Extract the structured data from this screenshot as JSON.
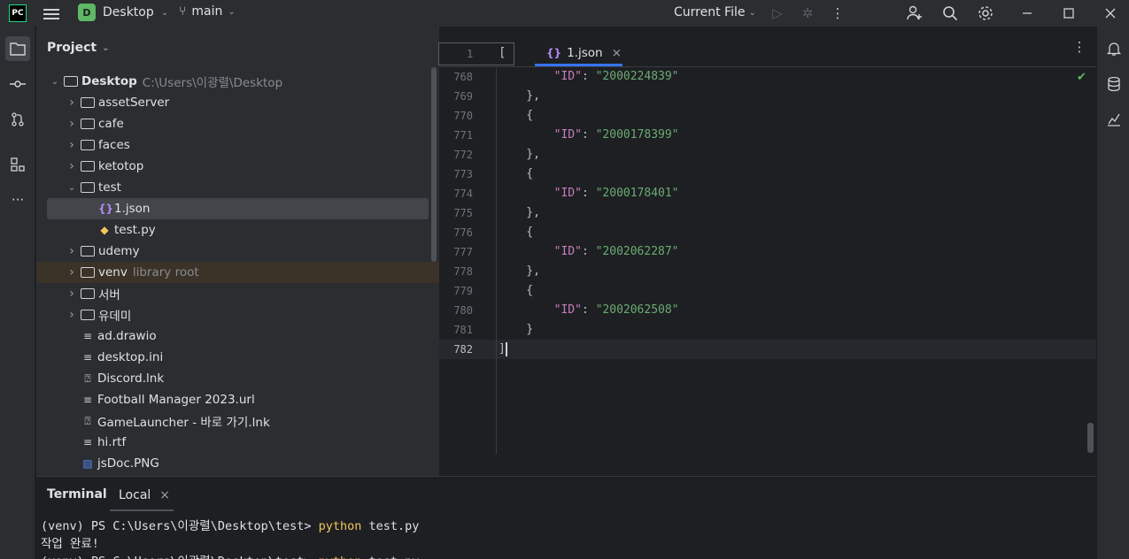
{
  "titlebar": {
    "logo": "PC",
    "project_badge": "D",
    "project_name": "Desktop",
    "branch": "main",
    "run_config": "Current File"
  },
  "project_panel": {
    "title": "Project",
    "tree": [
      {
        "label": "Desktop",
        "path": "C:\\Users\\이광렬\\Desktop",
        "type": "folder",
        "expanded": true
      },
      {
        "label": "assetServer",
        "type": "folder"
      },
      {
        "label": "cafe",
        "type": "folder"
      },
      {
        "label": "faces",
        "type": "folder"
      },
      {
        "label": "ketotop",
        "type": "folder"
      },
      {
        "label": "test",
        "type": "folder",
        "expanded": true
      },
      {
        "label": "1.json",
        "type": "json",
        "selected": true
      },
      {
        "label": "test.py",
        "type": "python"
      },
      {
        "label": "udemy",
        "type": "folder"
      },
      {
        "label": "venv",
        "note": "library root",
        "type": "folder"
      },
      {
        "label": "서버",
        "type": "folder"
      },
      {
        "label": "유데미",
        "type": "folder"
      },
      {
        "label": "ad.drawio",
        "type": "text"
      },
      {
        "label": "desktop.ini",
        "type": "text"
      },
      {
        "label": "Discord.lnk",
        "type": "unknown"
      },
      {
        "label": "Football Manager 2023.url",
        "type": "text"
      },
      {
        "label": "GameLauncher - 바로 가기.lnk",
        "type": "unknown"
      },
      {
        "label": "hi.rtf",
        "type": "text"
      },
      {
        "label": "jsDoc.PNG",
        "type": "image"
      }
    ]
  },
  "editor": {
    "tab_label": "1.json",
    "sticky_line_number": "1",
    "sticky_line_text": "[",
    "lines": [
      {
        "n": "768",
        "indent": "        ",
        "key": "\"ID\"",
        "sep": ": ",
        "value": "\"2000224839\""
      },
      {
        "n": "769",
        "text": "    },"
      },
      {
        "n": "770",
        "text": "    {"
      },
      {
        "n": "771",
        "indent": "        ",
        "key": "\"ID\"",
        "sep": ": ",
        "value": "\"2000178399\""
      },
      {
        "n": "772",
        "text": "    },"
      },
      {
        "n": "773",
        "text": "    {"
      },
      {
        "n": "774",
        "indent": "        ",
        "key": "\"ID\"",
        "sep": ": ",
        "value": "\"2000178401\""
      },
      {
        "n": "775",
        "text": "    },"
      },
      {
        "n": "776",
        "text": "    {"
      },
      {
        "n": "777",
        "indent": "        ",
        "key": "\"ID\"",
        "sep": ": ",
        "value": "\"2002062287\""
      },
      {
        "n": "778",
        "text": "    },"
      },
      {
        "n": "779",
        "text": "    {"
      },
      {
        "n": "780",
        "indent": "        ",
        "key": "\"ID\"",
        "sep": ": ",
        "value": "\"2002062508\""
      },
      {
        "n": "781",
        "text": "    }"
      },
      {
        "n": "782",
        "text": "]",
        "current": true
      }
    ]
  },
  "terminal": {
    "title": "Terminal",
    "tab_label": "Local",
    "lines": [
      {
        "prompt": "(venv) PS C:\\Users\\이광렬\\Desktop\\test> ",
        "cmd": "python",
        "args": " test.py"
      },
      {
        "text": "작업 완료!"
      },
      {
        "prompt": "(venv) PS C:\\Users\\이광렬\\Desktop\\test> ",
        "cmd": "python",
        "args": " test.py"
      }
    ]
  }
}
